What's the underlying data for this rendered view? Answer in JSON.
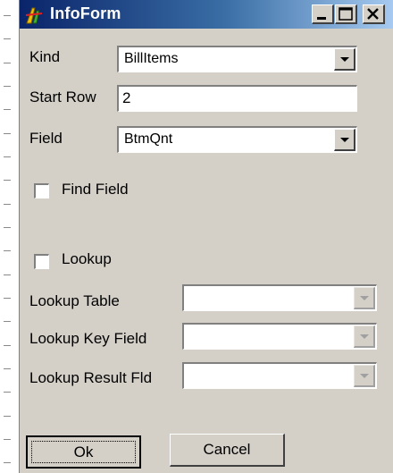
{
  "window": {
    "title": "InfoForm",
    "icon": "app-icon",
    "controls": [
      "minimize-icon",
      "maximize-icon",
      "close-icon"
    ]
  },
  "form": {
    "kind_label": "Kind",
    "kind_value": "BillItems",
    "start_row_label": "Start Row",
    "start_row_value": "2",
    "field_label": "Field",
    "field_value": "BtmQnt",
    "find_field_label": "Find Field",
    "find_field_checked": false,
    "lookup_label": "Lookup",
    "lookup_checked": false,
    "lookup_table_label": "Lookup Table",
    "lookup_table_value": "",
    "lookup_key_field_label": "Lookup Key Field",
    "lookup_key_field_value": "",
    "lookup_result_fld_label": "Lookup Result Fld",
    "lookup_result_fld_value": ""
  },
  "buttons": {
    "ok_label": "Ok",
    "cancel_label": "Cancel"
  },
  "colors": {
    "face": "#d4d0c8",
    "title_start": "#0a246a",
    "title_end": "#a6caf0"
  }
}
